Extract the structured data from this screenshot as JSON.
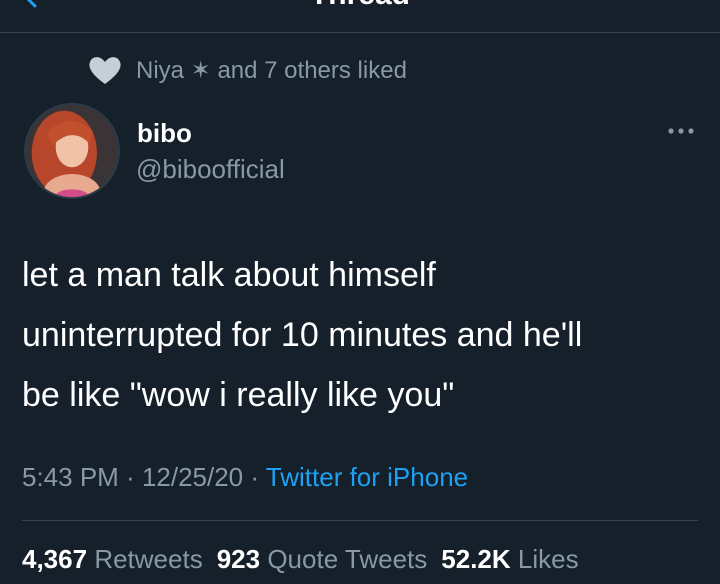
{
  "nav": {
    "title": "Thread"
  },
  "social_context": {
    "text": "Niya ✶ and 7 others liked"
  },
  "author": {
    "display_name": "bibo",
    "handle": "@biboofficial"
  },
  "tweet": {
    "lines": [
      "let a man talk about himself",
      "uninterrupted for 10 minutes and he'll",
      "be like \"wow i really like you\""
    ]
  },
  "meta": {
    "time": "5:43 PM",
    "sep1": " · ",
    "date": "12/25/20",
    "sep2": " · ",
    "source": "Twitter for iPhone"
  },
  "stats": {
    "retweets_count": "4,367",
    "retweets_label": "Retweets",
    "quotes_count": "923",
    "quotes_label": "Quote Tweets",
    "likes_count": "52.2K",
    "likes_label": "Likes"
  },
  "colors": {
    "background": "#15202b",
    "accent": "#1da1f2",
    "secondary_text": "#8899a6",
    "divider": "#38444d"
  },
  "icons": {
    "back": "chevron-left-icon",
    "heart": "heart-icon",
    "more": "more-horizontal-icon"
  }
}
